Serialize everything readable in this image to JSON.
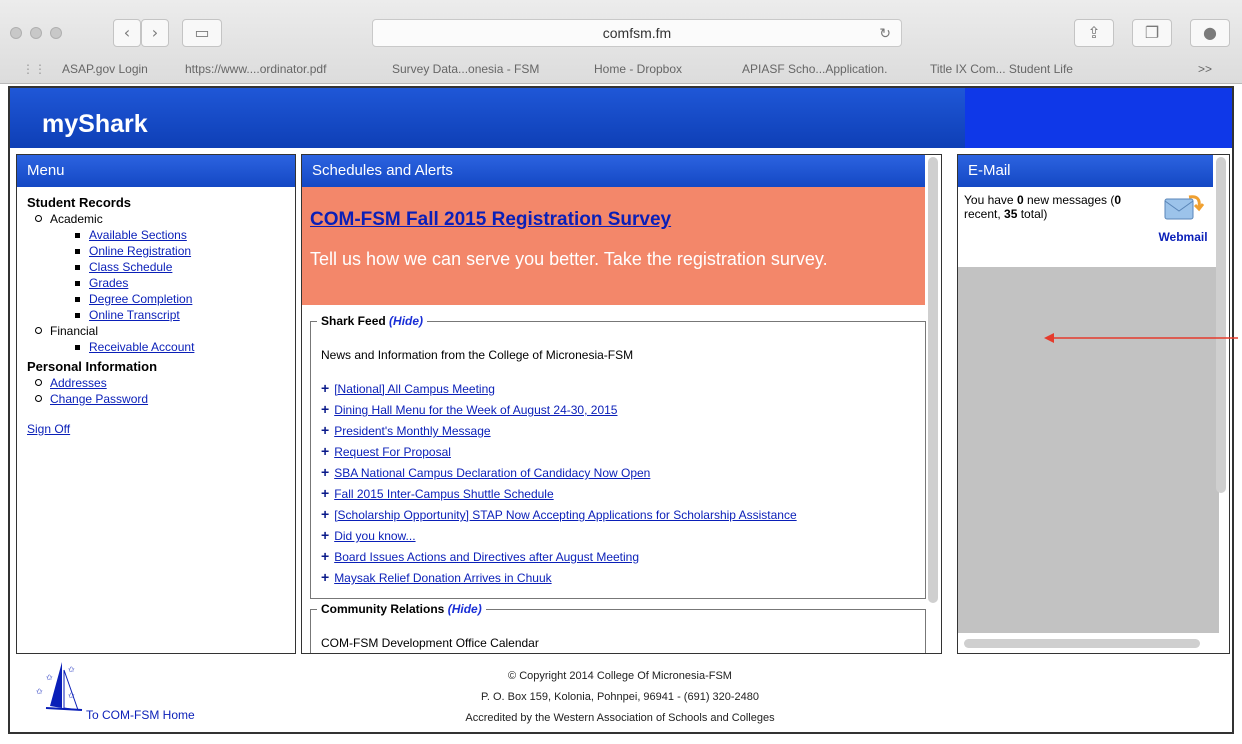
{
  "browser": {
    "url": "comfsm.fm",
    "bookmarks": [
      "ASAP.gov Login",
      "https://www....ordinator.pdf",
      "Survey Data...onesia - FSM",
      "Home - Dropbox",
      "APIASF Scho...Application.",
      "Title IX Com... Student Life"
    ],
    "more": ">>"
  },
  "header": {
    "logo_prefix": "my",
    "logo_suffix": "Shark"
  },
  "menu": {
    "title": "Menu",
    "student_records": "Student Records",
    "academic": "Academic",
    "academic_items": [
      "Available Sections",
      "Online Registration",
      "Class Schedule",
      "Grades",
      "Degree Completion",
      "Online Transcript"
    ],
    "financial": "Financial",
    "financial_items": [
      "Receivable Account"
    ],
    "personal_information": "Personal Information",
    "personal_items": [
      "Addresses",
      "Change Password"
    ],
    "sign_off": "Sign Off"
  },
  "schedules": {
    "title": "Schedules and Alerts",
    "survey_link": "COM-FSM Fall 2015 Registration Survey",
    "survey_text": "Tell us how we can serve you better. Take the registration survey.",
    "shark_feed": {
      "label": "Shark Feed",
      "hide": "(Hide)",
      "intro": "News and Information from the College of Micronesia-FSM",
      "items": [
        "[National] All Campus Meeting",
        "Dining Hall Menu for the Week of August 24-30, 2015",
        "President's Monthly Message",
        "Request For Proposal",
        "SBA National Campus Declaration of Candidacy Now Open",
        "Fall 2015 Inter-Campus Shuttle Schedule",
        "[Scholarship Opportunity] STAP Now Accepting Applications for Scholarship Assistance",
        "Did you know...",
        "Board Issues Actions and Directives after August Meeting",
        "Maysak Relief Donation Arrives in Chuuk"
      ]
    },
    "community": {
      "label": "Community Relations",
      "hide": "(Hide)",
      "intro": "COM-FSM Development Office Calendar"
    }
  },
  "email": {
    "title": "E-Mail",
    "t1": "You have ",
    "new_count": "0",
    "t2": " new messages (",
    "recent_count": "0",
    "t3": " recent, ",
    "total_count": "35",
    "t4": " total)",
    "webmail": "Webmail"
  },
  "footer": {
    "home_link": "To COM-FSM Home",
    "copyright": "© Copyright 2014 College Of Micronesia-FSM",
    "address": "P. O. Box 159, Kolonia, Pohnpei, 96941 - (691) 320-2480",
    "accreditation": "Accredited by the Western Association of Schools and Colleges"
  },
  "colors": {
    "banner": "#1f57d7",
    "alert": "#f3876a",
    "link": "#0a1fb8",
    "annotation_arrow": "#e53b2c"
  }
}
